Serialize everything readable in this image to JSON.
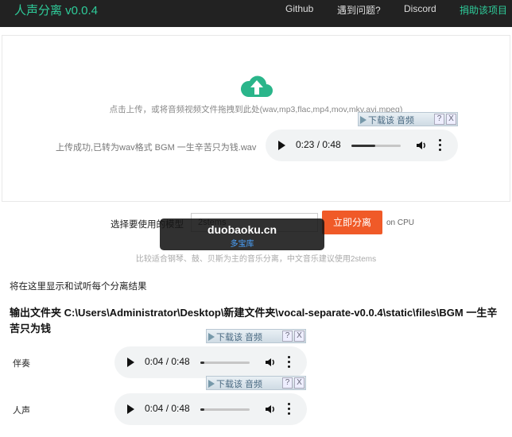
{
  "navbar": {
    "brand": "人声分离 v0.0.4",
    "links": [
      "Github",
      "遇到问题?",
      "Discord"
    ],
    "donate": "捐助该项目"
  },
  "upload": {
    "icon": "cloud-upload-icon",
    "hint": "点击上传，或将音频视频文件拖拽到此处(wav,mp3,flac,mp4,mov,mkv,avi,mpeg)",
    "status": "上传成功,已转为wav格式 BGM 一生辛苦只为钱.wav",
    "player": {
      "time": "0:23 / 0:48",
      "progress": 0.48
    }
  },
  "download_toolbar": {
    "label": "下载该 音频",
    "help": "?",
    "close": "X"
  },
  "model": {
    "label": "选择要使用的模型",
    "selected": "2stems",
    "separate_button": "立即分离",
    "device": "on CPU",
    "hint": "比较适合钢琴、鼓、贝斯为主的音乐分离，中文音乐建议使用2stems"
  },
  "watermark": {
    "title": "duobaoku.cn",
    "subtitle": "多宝库"
  },
  "results": {
    "hint": "将在这里显示和试听每个分离结果",
    "output_path": "输出文件夹 C:\\Users\\Administrator\\Desktop\\新建文件夹\\vocal-separate-v0.0.4\\static\\files\\BGM 一生辛苦只为钱",
    "tracks": [
      {
        "label": "伴奏",
        "time": "0:04 / 0:48",
        "progress": 0.08
      },
      {
        "label": "人声",
        "time": "0:04 / 0:48",
        "progress": 0.08
      }
    ]
  },
  "colors": {
    "accent": "#2ecc9a",
    "button": "#f05a28",
    "navbar": "#222222"
  }
}
